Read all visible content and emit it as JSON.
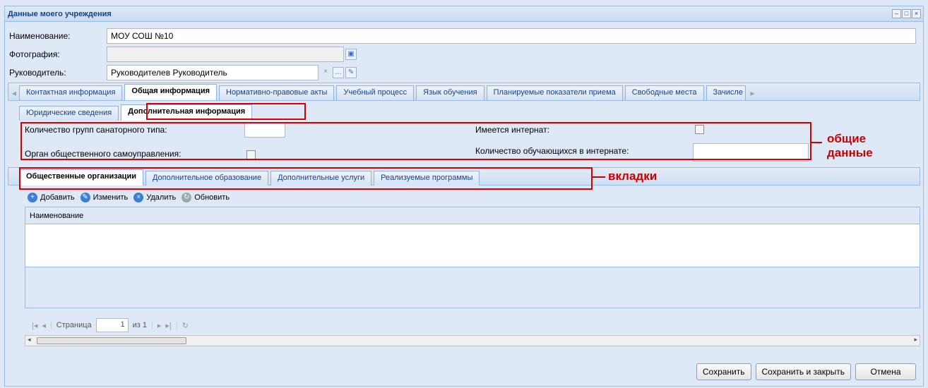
{
  "window": {
    "title": "Данные моего учреждения"
  },
  "fields": {
    "name_label": "Наименование:",
    "name_value": "МОУ СОШ №10",
    "photo_label": "Фотография:",
    "head_label": "Руководитель:",
    "head_value": "Руководителев Руководитель"
  },
  "main_tabs": [
    {
      "label": "Контактная информация"
    },
    {
      "label": "Общая информация"
    },
    {
      "label": "Нормативно-правовые акты"
    },
    {
      "label": "Учебный процесс"
    },
    {
      "label": "Язык обучения"
    },
    {
      "label": "Планируемые показатели приема"
    },
    {
      "label": "Свободные места"
    },
    {
      "label": "Зачисле"
    }
  ],
  "sub_tabs": [
    {
      "label": "Юридические сведения"
    },
    {
      "label": "Дополнительная информация"
    }
  ],
  "general": {
    "groups_label": "Количество групп санаторного типа:",
    "selfgov_label": "Орган общественного самоуправления:",
    "boarding_label": "Имеется интернат:",
    "boarding_count_label": "Количество обучающихся в интернате:",
    "note": "общие данные"
  },
  "inner_tabs": [
    {
      "label": "Общественные организации"
    },
    {
      "label": "Дополнительное образование"
    },
    {
      "label": "Дополнительные услуги"
    },
    {
      "label": "Реализуемые программы"
    }
  ],
  "tabs_note": "вкладки",
  "toolbar": {
    "add": "Добавить",
    "edit": "Изменить",
    "delete": "Удалить",
    "refresh": "Обновить"
  },
  "grid": {
    "header": "Наименование"
  },
  "pager": {
    "page_label": "Страница",
    "page_value": "1",
    "of": "из 1"
  },
  "buttons": {
    "save": "Сохранить",
    "save_close": "Сохранить и закрыть",
    "cancel": "Отмена"
  },
  "colors": {
    "accent": "#15428b",
    "annotation": "#d60000"
  }
}
